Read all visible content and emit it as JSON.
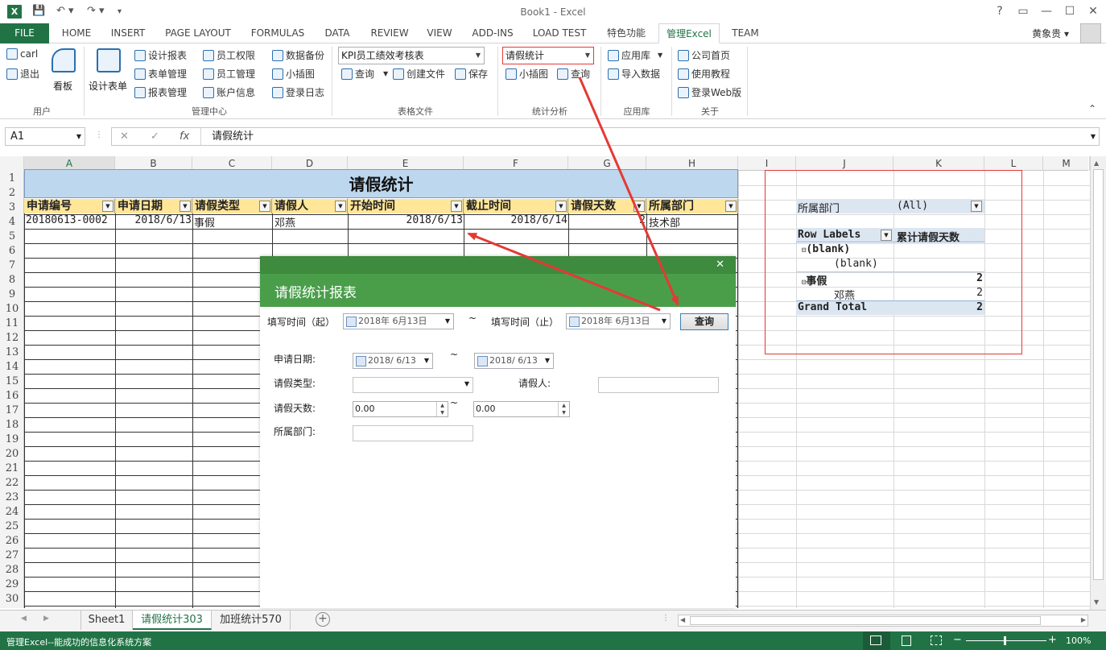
{
  "window": {
    "title": "Book1 - Excel"
  },
  "qat": {
    "logo": "X",
    "save": "💾",
    "undo": "↶ ▾",
    "redo": "↷ ▾",
    "more": "▾"
  },
  "controls": {
    "help": "?",
    "ribbon_display": "▭",
    "minimize": "—",
    "maximize": "☐",
    "close": "✕"
  },
  "tabs": [
    "FILE",
    "HOME",
    "INSERT",
    "PAGE LAYOUT",
    "FORMULAS",
    "DATA",
    "REVIEW",
    "VIEW",
    "ADD-INS",
    "LOAD TEST",
    "特色功能",
    "管理Excel",
    "TEAM"
  ],
  "active_tab": "管理Excel",
  "user": {
    "name": "黄象贵 ▾"
  },
  "ribbon": {
    "user_group": {
      "label": "用户",
      "carl": "carl",
      "logout": "退出",
      "board": "看板"
    },
    "mgmt_group": {
      "label": "管理中心",
      "design_form": "设计表单",
      "design_report": "设计报表",
      "form_mgmt": "表单管理",
      "report_mgmt": "报表管理",
      "staff_perm": "员工权限",
      "staff_mgmt": "员工管理",
      "account_info": "账户信息",
      "backup": "数据备份",
      "widget": "小插图",
      "login_log": "登录日志"
    },
    "file_group": {
      "label": "表格文件",
      "combo": "KPI员工绩效考核表",
      "query": "查询",
      "create": "创建文件",
      "save": "保存"
    },
    "stats_group": {
      "label": "统计分析",
      "combo": "请假统计",
      "widget": "小插图",
      "query": "查询"
    },
    "app_group": {
      "label": "应用库",
      "store": "应用库",
      "import": "导入数据"
    },
    "about_group": {
      "label": "关于",
      "home": "公司首页",
      "tutorial": "使用教程",
      "web": "登录Web版"
    },
    "collapse": "⌃"
  },
  "formula": {
    "namebox": "A1",
    "value": "请假统计",
    "cancel": "✕",
    "enter": "✓",
    "fx": "fx"
  },
  "columns": [
    "A",
    "B",
    "C",
    "D",
    "E",
    "F",
    "G",
    "H",
    "I",
    "J",
    "K",
    "L",
    "M"
  ],
  "rows": [
    "1",
    "2",
    "3",
    "4",
    "5",
    "6",
    "7",
    "8",
    "9",
    "10",
    "11",
    "12",
    "13",
    "14",
    "15",
    "16",
    "17",
    "18",
    "19",
    "20",
    "21",
    "22",
    "23",
    "24",
    "25",
    "26",
    "27",
    "28",
    "29",
    "30"
  ],
  "sheet": {
    "title": "请假统计",
    "headers": [
      "申请编号",
      "申请日期",
      "请假类型",
      "请假人",
      "开始时间",
      "截止时间",
      "请假天数",
      "所属部门"
    ],
    "row4": [
      "20180613-0002",
      "2018/6/13",
      "事假",
      "邓燕",
      "2018/6/13",
      "2018/6/14",
      "2",
      "技术部"
    ]
  },
  "pivot": {
    "filter_label": "所属部门",
    "filter_value": "(All)",
    "row_labels": "Row Labels",
    "value_header": "累计请假天数",
    "items": [
      {
        "label": "(blank)",
        "value": "",
        "child": "(blank)",
        "child_value": ""
      },
      {
        "label": "事假",
        "value": "2",
        "child": "邓燕",
        "child_value": "2"
      }
    ],
    "grand_total_label": "Grand Total",
    "grand_total": "2"
  },
  "dialog": {
    "close": "✕",
    "title": "请假统计报表",
    "fill_start_label": "填写时间（起）",
    "fill_start": "2018年 6月13日",
    "tilde": "~",
    "fill_end_label": "填写时间（止）",
    "fill_end": "2018年 6月13日",
    "query": "查询",
    "apply_date_label": "申请日期:",
    "apply_date_from": "2018/ 6/13",
    "apply_date_to": "2018/ 6/13",
    "leave_type_label": "请假类型:",
    "leave_type": "",
    "person_label": "请假人:",
    "person": "",
    "days_label": "请假天数:",
    "days_from": "0.00",
    "days_to": "0.00",
    "dept_label": "所属部门:",
    "dept": ""
  },
  "sheet_tabs": [
    "Sheet1",
    "请假统计303",
    "加班统计570"
  ],
  "active_sheet": "请假统计303",
  "status": {
    "text": "管理Excel--能成功的信息化系统方案",
    "zoom": "100%"
  },
  "colors": {
    "excel_green": "#217346",
    "dialog_green": "#4a9e4a",
    "header_fill": "#ffe699",
    "title_fill": "#bdd7ee",
    "annotation_red": "#e53935"
  }
}
